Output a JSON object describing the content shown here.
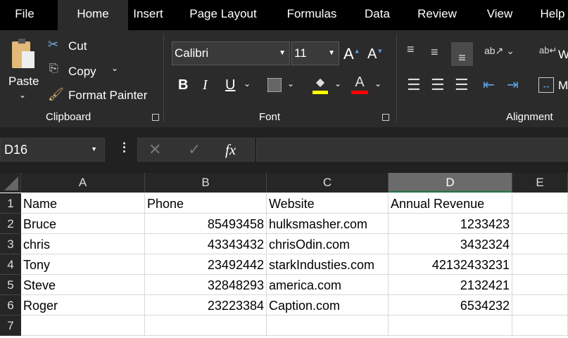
{
  "tabs": [
    "File",
    "Home",
    "Insert",
    "Page Layout",
    "Formulas",
    "Data",
    "Review",
    "View",
    "Help"
  ],
  "active_tab": "Home",
  "ribbon": {
    "clipboard": {
      "paste": "Paste",
      "cut": "Cut",
      "copy": "Copy",
      "format_painter": "Format Painter",
      "group_label": "Clipboard"
    },
    "font": {
      "font_name": "Calibri",
      "font_size": "11",
      "bold": "B",
      "italic": "I",
      "underline": "U",
      "group_label": "Font",
      "fill_color": "#ffff00",
      "font_color": "#ff0000"
    },
    "alignment": {
      "wrap_text": "W",
      "merge": "M",
      "group_label": "Alignment"
    }
  },
  "formula_bar": {
    "name_box": "D16",
    "fx": "fx",
    "value": ""
  },
  "columns": [
    "A",
    "B",
    "C",
    "D",
    "E"
  ],
  "selected_column": "D",
  "rows": [
    "1",
    "2",
    "3",
    "4",
    "5",
    "6",
    "7"
  ],
  "cells": [
    [
      "Name",
      "Phone",
      "Website",
      "Annual Revenue"
    ],
    [
      "Bruce",
      "85493458",
      "hulksmasher.com",
      "1233423"
    ],
    [
      "chris",
      "43343432",
      "chrisOdin.com",
      "3432324"
    ],
    [
      "Tony",
      "23492442",
      "starkIndusties.com",
      "42132433231"
    ],
    [
      "Steve",
      "32848293",
      "america.com",
      "2132421"
    ],
    [
      "Roger",
      "23223384",
      "Caption.com",
      "6534232"
    ],
    [
      "",
      "",
      "",
      ""
    ]
  ]
}
